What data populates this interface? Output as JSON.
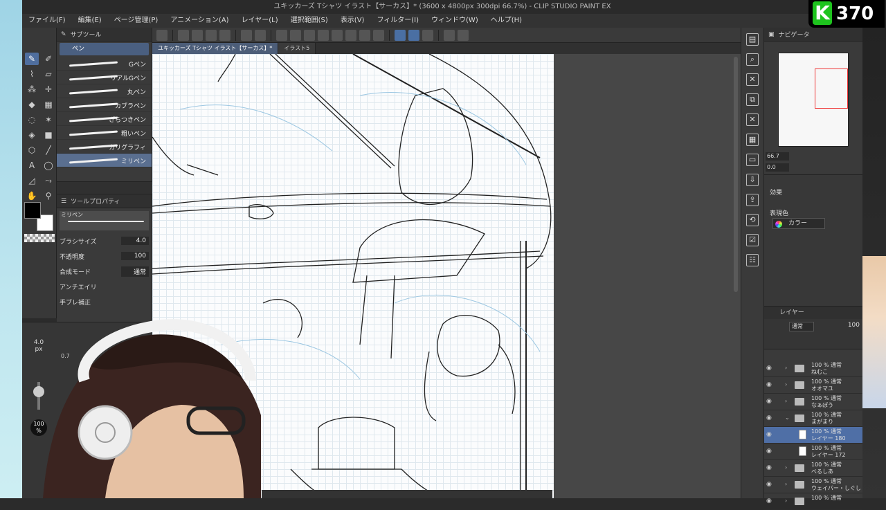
{
  "window": {
    "title": "ユキッカーズ Tシャツ イラスト【サーカス】* (3600 x 4800px 300dpi 66.7%) - CLIP STUDIO PAINT EX"
  },
  "menu": [
    "ファイル(F)",
    "編集(E)",
    "ページ管理(P)",
    "アニメーション(A)",
    "レイヤー(L)",
    "選択範囲(S)",
    "表示(V)",
    "フィルター(I)",
    "ウィンドウ(W)",
    "ヘルプ(H)"
  ],
  "subtool": {
    "panel_title": "サブツール",
    "group_tab": "ペン",
    "brushes": [
      "Gペン",
      "リアルGペン",
      "丸ペン",
      "カブラペン",
      "ざらつきペン",
      "粗いペン",
      "カリグラフィ",
      "ミリペン"
    ],
    "selected_index": 7
  },
  "tool_property": {
    "panel_title": "ツールプロパティ",
    "preview_label": "ミリペン",
    "brush_size_label": "ブラシサイズ",
    "brush_size_value": "4.0",
    "opacity_label": "不透明度",
    "opacity_value": "100",
    "blend_label": "合成モード",
    "blend_value": "通常",
    "antialias_label": "アンチエイリ",
    "stabilization_label": "手ブレ補正"
  },
  "size_panel": {
    "size_value": "4.0",
    "size_unit": "px",
    "secondary_value": "0.7",
    "percent_value": "100",
    "percent_unit": "%"
  },
  "canvas": {
    "tabs": [
      "ユキッカーズ Tシャツ イラスト【サーカス】*",
      "イラスト5"
    ],
    "active_tab": 0
  },
  "navigator": {
    "title": "ナビゲータ",
    "zoom": "66.7",
    "rotation": "0.0"
  },
  "effects": {
    "title": "効果",
    "color_label": "表現色",
    "color_value": "カラー"
  },
  "layers": {
    "title": "レイヤー",
    "blend": "通常",
    "opacity": "100",
    "items": [
      {
        "line1": "100 % 通常",
        "line2": "ねむこ",
        "type": "folder",
        "arrow": "›",
        "selected": false
      },
      {
        "line1": "100 % 通常",
        "line2": "オオマユ",
        "type": "folder",
        "arrow": "›",
        "selected": false
      },
      {
        "line1": "100 % 通常",
        "line2": "なぁぽう",
        "type": "folder",
        "arrow": "›",
        "selected": false
      },
      {
        "line1": "100 % 通常",
        "line2": "まがまり",
        "type": "folder",
        "arrow": "⌄",
        "selected": false
      },
      {
        "line1": "100 % 通常",
        "line2": "レイヤー 180",
        "type": "layer",
        "arrow": "",
        "selected": true
      },
      {
        "line1": "100 % 通常",
        "line2": "レイヤー 172",
        "type": "layer",
        "arrow": "",
        "selected": false
      },
      {
        "line1": "100 % 通常",
        "line2": "べるしあ",
        "type": "folder",
        "arrow": "›",
        "selected": false
      },
      {
        "line1": "100 % 通常",
        "line2": "ウェイバー・しぐし",
        "type": "folder",
        "arrow": "›",
        "selected": false
      },
      {
        "line1": "100 % 通常",
        "line2": "",
        "type": "folder",
        "arrow": "›",
        "selected": false
      }
    ]
  },
  "overlay": {
    "badge_letter": "K",
    "badge_number": "370"
  },
  "colors": {
    "accent": "#4f6e9e",
    "badge_green": "#1ec41e",
    "selection": "#4f6fa6"
  }
}
